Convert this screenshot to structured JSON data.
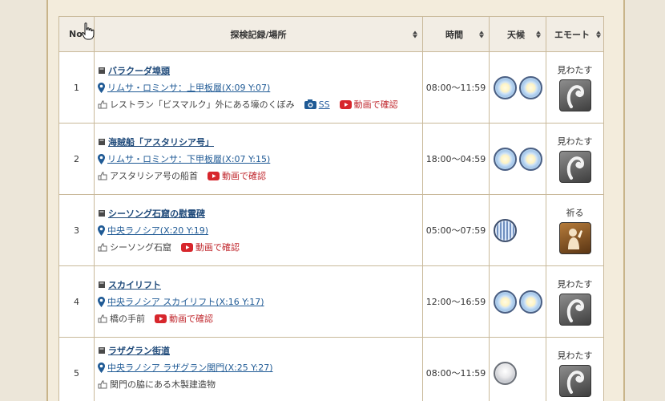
{
  "columns": {
    "no": "No",
    "record": "探検記録/場所",
    "time": "時間",
    "weather": "天候",
    "emote": "エモート"
  },
  "rows": [
    {
      "no": "1",
      "title": "バラクーダ埠頭",
      "location": "リムサ・ロミンサ：上甲板層(X:09 Y:07)",
      "desc": "レストラン「ビスマルク」外にある壕のくぼみ",
      "ss": "SS",
      "video": "動画で確認",
      "time": "08:00～11:59",
      "weather": [
        "clear",
        "fair"
      ],
      "emote": "見わたす"
    },
    {
      "no": "2",
      "title": "海賊船「アスタリシア号」",
      "location": "リムサ・ロミンサ：下甲板層(X:07 Y:15)",
      "desc": "アスタリシア号の船首",
      "video": "動画で確認",
      "time": "18:00～04:59",
      "weather": [
        "clear",
        "fair"
      ],
      "emote": "見わたす"
    },
    {
      "no": "3",
      "title": "シーソング石窟の慰霊碑",
      "location": "中央ラノシア(X:20 Y:19)",
      "desc": "シーソング石窟",
      "video": "動画で確認",
      "time": "05:00～07:59",
      "weather": [
        "rain"
      ],
      "emote": "祈る"
    },
    {
      "no": "4",
      "title": "スカイリフト",
      "location": "中央ラノシア スカイリフト(X:16 Y:17)",
      "desc": "橋の手前",
      "video": "動画で確認",
      "time": "12:00～16:59",
      "weather": [
        "clear",
        "fair"
      ],
      "emote": "見わたす"
    },
    {
      "no": "5",
      "title": "ラザグラン街道",
      "location": "中央ラノシア ラザグラン関門(X:25 Y:27)",
      "desc": "関門の脇にある木製建造物",
      "time": "08:00～11:59",
      "weather": [
        "cloud"
      ],
      "emote": "見わたす"
    }
  ],
  "colors": {
    "link": "#1f5a95",
    "youtube": "#c0282e",
    "border": "#c9b99a",
    "header_bg": "#f2ede4",
    "page_bg": "#ece6d9"
  }
}
